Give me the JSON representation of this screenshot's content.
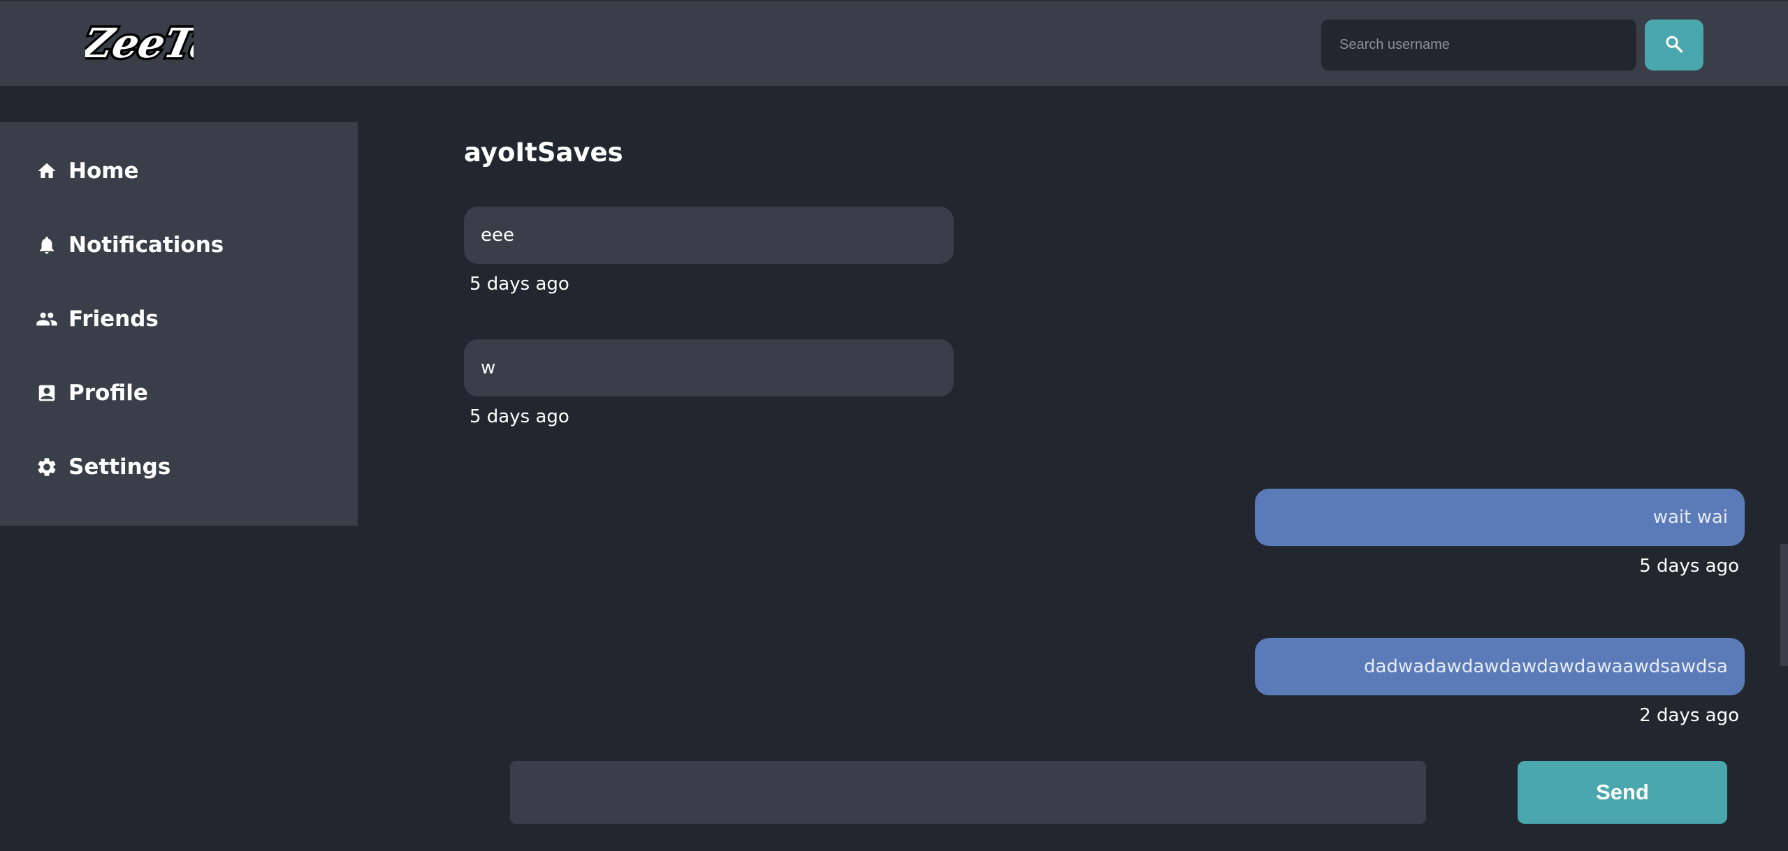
{
  "header": {
    "logo_text": "ZeeTaa",
    "search": {
      "placeholder": "Search username",
      "value": ""
    },
    "search_icon": "search-icon"
  },
  "sidebar": {
    "items": [
      {
        "label": "Home",
        "icon": "home-icon"
      },
      {
        "label": "Notifications",
        "icon": "bell-icon"
      },
      {
        "label": "Friends",
        "icon": "people-icon"
      },
      {
        "label": "Profile",
        "icon": "profile-card-icon"
      },
      {
        "label": "Settings",
        "icon": "gear-icon"
      }
    ]
  },
  "chat": {
    "title": "ayoItSaves",
    "messages": [
      {
        "text": "eee",
        "time": "5 days ago",
        "direction": "incoming"
      },
      {
        "text": "w",
        "time": "5 days ago",
        "direction": "incoming"
      },
      {
        "text": "wait wai",
        "time": "5 days ago",
        "direction": "outgoing"
      },
      {
        "text": "dadwadawdawdawdawdawaawdsawdsa",
        "time": "2 days ago",
        "direction": "outgoing"
      }
    ]
  },
  "composer": {
    "value": "",
    "send_label": "Send"
  },
  "colors": {
    "background": "#22262f",
    "panel": "#3a3e48",
    "accent": "#4aa7ad",
    "outgoing_bubble": "#5b7bb8"
  }
}
